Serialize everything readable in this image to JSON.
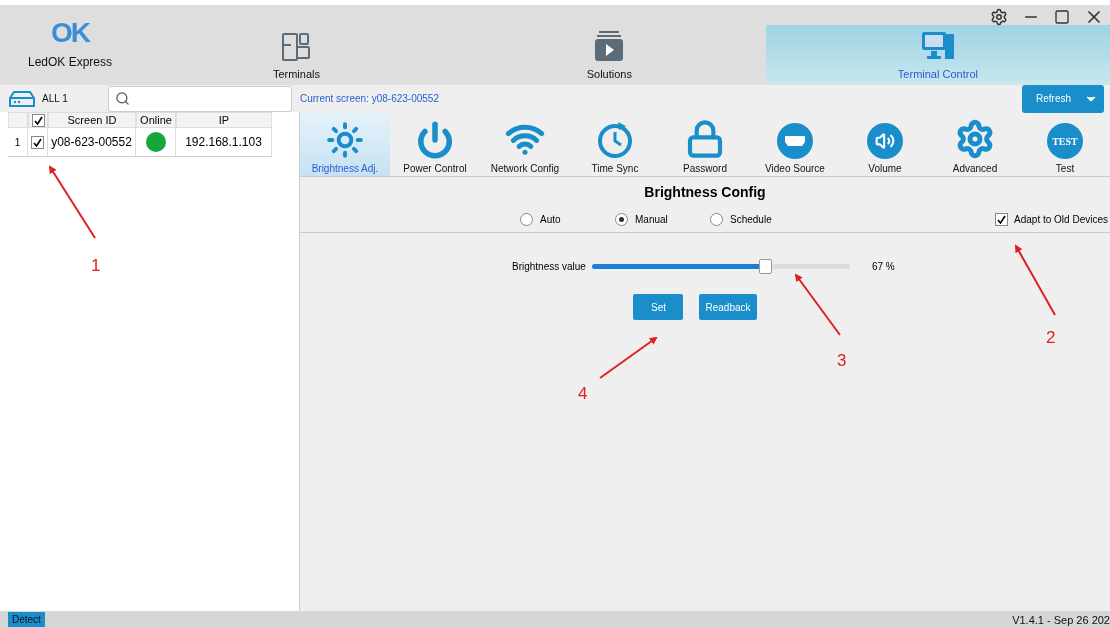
{
  "app": {
    "logo_text": "OK",
    "name": "LedOK Express"
  },
  "nav_tabs": [
    {
      "label": "Terminals",
      "kind": "terminals",
      "selected": false
    },
    {
      "label": "Solutions",
      "kind": "solutions",
      "selected": false
    },
    {
      "label": "Terminal Control",
      "kind": "control",
      "selected": true
    }
  ],
  "toolbar": {
    "group_label": "ALL 1",
    "current_screen": "Current screen: y08-623-00552",
    "refresh_button": "Refresh"
  },
  "table": {
    "header_checked": true,
    "columns": [
      "Screen ID",
      "Online",
      "IP"
    ],
    "rows": [
      {
        "number": "1",
        "checked": true,
        "screen_id": "y08-623-00552",
        "online": true,
        "ip": "192.168.1.103"
      }
    ]
  },
  "functions": [
    {
      "label": "Brightness Adj.",
      "kind": "sun",
      "selected": true
    },
    {
      "label": "Power Control",
      "kind": "power",
      "selected": false
    },
    {
      "label": "Network Config",
      "kind": "wifi",
      "selected": false
    },
    {
      "label": "Time Sync",
      "kind": "clock",
      "selected": false
    },
    {
      "label": "Password",
      "kind": "lock",
      "selected": false
    },
    {
      "label": "Video Source",
      "kind": "video",
      "selected": false
    },
    {
      "label": "Volume",
      "kind": "volume",
      "selected": false
    },
    {
      "label": "Advanced",
      "kind": "gear",
      "selected": false
    },
    {
      "label": "Test",
      "kind": "test",
      "icon_text": "TEST",
      "selected": false
    }
  ],
  "brightness": {
    "title": "Brightness Config",
    "modes": [
      {
        "label": "Auto",
        "selected": false
      },
      {
        "label": "Manual",
        "selected": true
      },
      {
        "label": "Schedule",
        "selected": false
      }
    ],
    "adapt": {
      "label": "Adapt to Old Devices",
      "checked": true
    },
    "slider": {
      "label": "Brightness value",
      "level": 0.67,
      "reading": "67 %"
    },
    "buttons": [
      "Set",
      "Readback"
    ]
  },
  "status_bar": {
    "detect_button": "Detect",
    "version": "V1.4.1 - Sep 26 202"
  },
  "annotations": [
    {
      "label": "1"
    },
    {
      "label": "2"
    },
    {
      "label": "3"
    },
    {
      "label": "4"
    }
  ]
}
